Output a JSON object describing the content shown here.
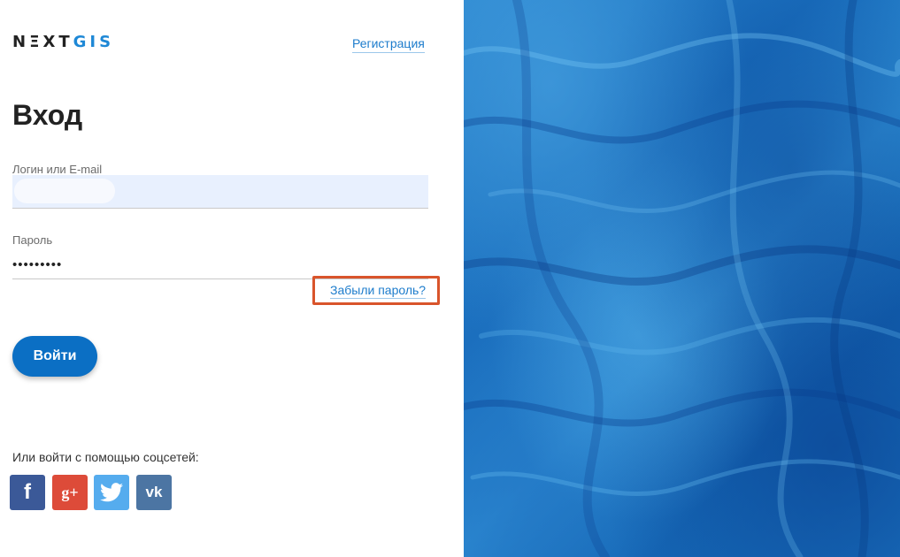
{
  "logo": {
    "part1": "NΞXT",
    "part2": "GIS"
  },
  "header": {
    "register_link": "Регистрация"
  },
  "form": {
    "title": "Вход",
    "login_label": "Логин или E-mail",
    "password_label": "Пароль",
    "password_value": "•••••••••",
    "forgot_link": "Забыли пароль?",
    "submit_label": "Войти"
  },
  "social": {
    "caption": "Или войти с помощью соцсетей:",
    "buttons": [
      {
        "name": "facebook",
        "glyph": "f",
        "color": "#3b5998"
      },
      {
        "name": "google-plus",
        "glyph": "g+",
        "color": "#dd4b39"
      },
      {
        "name": "twitter",
        "glyph": "twitter-bird",
        "color": "#55acee"
      },
      {
        "name": "vk",
        "glyph": "vk",
        "color": "#4c75a3"
      }
    ]
  },
  "colors": {
    "accent": "#0b6fc4",
    "link": "#1d7ccc",
    "highlight": "#d9542b",
    "map_blue": "#1a6fbe"
  }
}
